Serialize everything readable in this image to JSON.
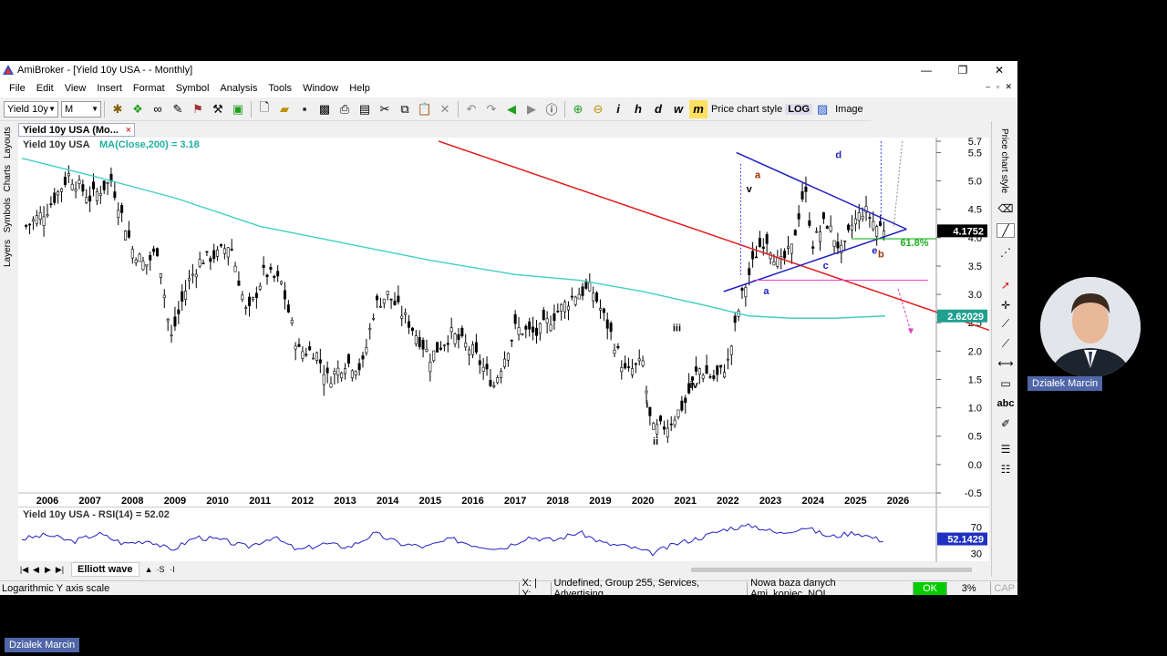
{
  "window": {
    "title": "AmiBroker - [Yield 10y USA -  - Monthly]",
    "minimize": "—",
    "maximize": "❐",
    "close": "✕"
  },
  "menu": [
    "File",
    "Edit",
    "View",
    "Insert",
    "Format",
    "Symbol",
    "Analysis",
    "Tools",
    "Window",
    "Help"
  ],
  "mdi_controls": "– ▫ ✕",
  "toolbar": {
    "symbol": "Yield 10y",
    "interval": "M",
    "price_chart_style": "Price chart style",
    "log_label": "LOG",
    "image_label": "Image"
  },
  "left_tabs": [
    "Layouts",
    "Charts",
    "Symbols",
    "Layers"
  ],
  "doc_tab": {
    "label": "Yield 10y USA (Mo...",
    "close": "×"
  },
  "chart": {
    "title_symbol": "Yield 10y USA",
    "ma_label": "MA(Close,200) = 3.18",
    "price_last": "4.1752",
    "ma_last": "2.62029",
    "fib_label": "61.8%",
    "wave_labels": [
      "a",
      "v",
      "d",
      "a",
      "c",
      "e",
      "b",
      "iii",
      "iv",
      "ii",
      "i"
    ],
    "ymin": -0.5,
    "ymax": 5.7
  },
  "chart_data": {
    "type": "line",
    "x_ticks": [
      "2006",
      "2007",
      "2008",
      "2009",
      "2010",
      "2011",
      "2012",
      "2013",
      "2014",
      "2015",
      "2016",
      "2017",
      "2018",
      "2019",
      "2020",
      "2021",
      "2022",
      "2023",
      "2024",
      "2025",
      "2026"
    ],
    "y_ticks": [
      "5.7",
      "5.5",
      "5.0",
      "4.5",
      "4.0",
      "3.5",
      "3.0",
      "2.5",
      "2.0",
      "1.5",
      "1.0",
      "0.5",
      "0.0",
      "-0.5"
    ],
    "ylim": [
      -0.5,
      5.7
    ],
    "series": [
      {
        "name": "Yield 10y USA",
        "x": [
          2005.5,
          2006.0,
          2006.5,
          2007.0,
          2007.5,
          2008.0,
          2008.3,
          2008.6,
          2008.9,
          2009.3,
          2009.6,
          2010.0,
          2010.3,
          2010.7,
          2011.1,
          2011.5,
          2011.9,
          2012.3,
          2012.6,
          2013.0,
          2013.4,
          2013.7,
          2014.0,
          2014.5,
          2015.0,
          2015.5,
          2016.0,
          2016.5,
          2017.0,
          2017.5,
          2018.0,
          2018.4,
          2018.8,
          2019.2,
          2019.6,
          2020.0,
          2020.2,
          2020.6,
          2021.0,
          2021.3,
          2021.7,
          2022.0,
          2022.3,
          2022.7,
          2022.9,
          2023.2,
          2023.5,
          2023.8,
          2024.0,
          2024.3,
          2024.7,
          2024.9,
          2025.2,
          2025.5,
          2025.7
        ],
        "values": [
          4.2,
          4.5,
          5.1,
          4.7,
          5.0,
          3.8,
          3.5,
          3.8,
          2.2,
          3.2,
          3.6,
          3.7,
          3.9,
          2.6,
          3.4,
          3.2,
          2.0,
          2.0,
          1.5,
          1.8,
          1.7,
          2.8,
          3.0,
          2.5,
          1.9,
          2.3,
          2.0,
          1.4,
          2.4,
          2.3,
          2.7,
          3.0,
          3.1,
          2.4,
          1.6,
          1.8,
          0.6,
          0.7,
          1.1,
          1.7,
          1.5,
          1.8,
          2.9,
          3.8,
          4.0,
          3.5,
          3.8,
          4.9,
          3.9,
          4.3,
          3.7,
          4.2,
          4.5,
          4.2,
          4.17
        ]
      },
      {
        "name": "MA(Close,200)",
        "x": [
          2005.4,
          2007,
          2009,
          2011,
          2013,
          2015,
          2017,
          2018.5,
          2020,
          2021.5,
          2022.5,
          2023.5,
          2024.5,
          2025.7
        ],
        "values": [
          5.4,
          5.1,
          4.7,
          4.2,
          3.9,
          3.6,
          3.35,
          3.25,
          3.05,
          2.8,
          2.62,
          2.58,
          2.58,
          2.62
        ]
      }
    ],
    "rsi": {
      "label": "Yield 10y USA - RSI(14) = 52.02",
      "last": "52.1429",
      "y_ticks": [
        "70",
        "30"
      ],
      "ylim": [
        20,
        80
      ],
      "x": [
        2005.4,
        2006.0,
        2006.6,
        2007.2,
        2007.8,
        2008.4,
        2008.9,
        2009.5,
        2010.1,
        2010.7,
        2011.3,
        2011.9,
        2012.5,
        2013.1,
        2013.7,
        2014.3,
        2014.9,
        2015.5,
        2016.1,
        2016.7,
        2017.3,
        2017.9,
        2018.5,
        2019.1,
        2019.7,
        2020.2,
        2020.8,
        2021.4,
        2022.0,
        2022.6,
        2023.2,
        2023.8,
        2024.4,
        2025.0,
        2025.6,
        2025.7
      ],
      "values": [
        52,
        58,
        48,
        60,
        45,
        50,
        35,
        55,
        50,
        40,
        55,
        35,
        45,
        40,
        60,
        45,
        40,
        52,
        42,
        38,
        55,
        50,
        62,
        45,
        40,
        30,
        45,
        55,
        68,
        72,
        60,
        70,
        55,
        62,
        50,
        52
      ]
    }
  },
  "sheet_bar": {
    "sheet": "Elliott wave",
    "nav": [
      "|◀",
      "◀",
      "▶",
      "▶|"
    ],
    "extra": [
      "▲",
      "·S",
      "·I"
    ]
  },
  "right_tools": {
    "label": "Price chart style",
    "abc": "abc"
  },
  "status": {
    "left": "Logarithmic Y axis scale",
    "xy": "X: | Y:",
    "group": "Undefined, Group 255, Services, Advertising",
    "db": "Nowa baza danych Ami_koniec_NOL",
    "ok": "OK",
    "pct": "3%",
    "cap": "CAP"
  },
  "presenter": {
    "name": "Działek Marcin",
    "badge_bottom": "Działek Marcin"
  },
  "colors": {
    "ma": "#40d0c0",
    "trend_red": "#e02020",
    "triangle": "#2020c0",
    "fib": "#20b020",
    "magenta": "#e040c0",
    "price_label": "#000",
    "ma_label": "#20a090"
  }
}
